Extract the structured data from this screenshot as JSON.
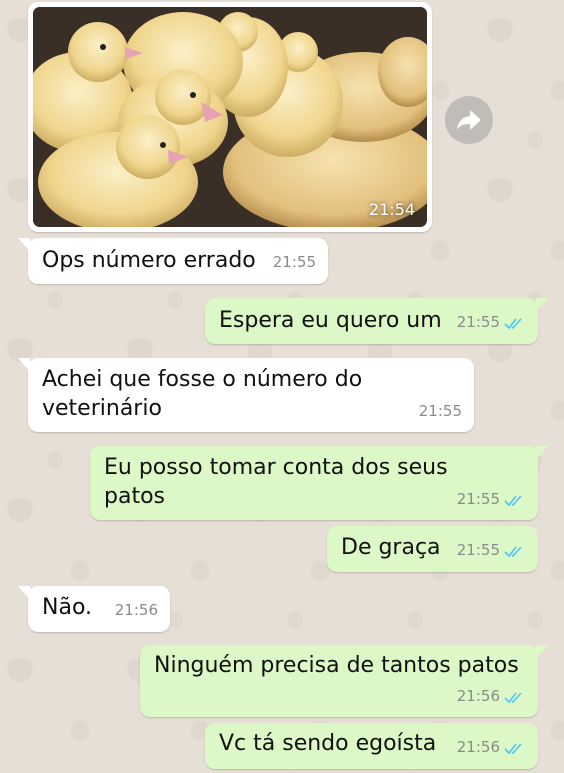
{
  "chat": {
    "image_message": {
      "time": "21:54"
    },
    "messages": [
      {
        "direction": "in",
        "text": "Ops número errado",
        "time": "21:55"
      },
      {
        "direction": "out",
        "text": "Espera eu quero um",
        "time": "21:55"
      },
      {
        "direction": "in",
        "text": "Achei que fosse o número do\nveterinário",
        "time": "21:55"
      },
      {
        "direction": "out",
        "text": "Eu posso tomar conta dos seus\npatos",
        "time": "21:55"
      },
      {
        "direction": "out",
        "text": "De graça",
        "time": "21:55"
      },
      {
        "direction": "in",
        "text": "Não.",
        "time": "21:56"
      },
      {
        "direction": "out",
        "text": "Ninguém precisa de tantos patos",
        "time": "21:56"
      },
      {
        "direction": "out",
        "text": "Vc tá sendo egoísta",
        "time": "21:56"
      }
    ]
  },
  "colors": {
    "incoming_bubble": "#ffffff",
    "outgoing_bubble": "#dcf8c6",
    "read_ticks": "#4fc3f7",
    "wallpaper": "#e6dfd6"
  },
  "icons": {
    "forward": "forward-arrow-icon",
    "read_receipt": "double-check-icon"
  }
}
